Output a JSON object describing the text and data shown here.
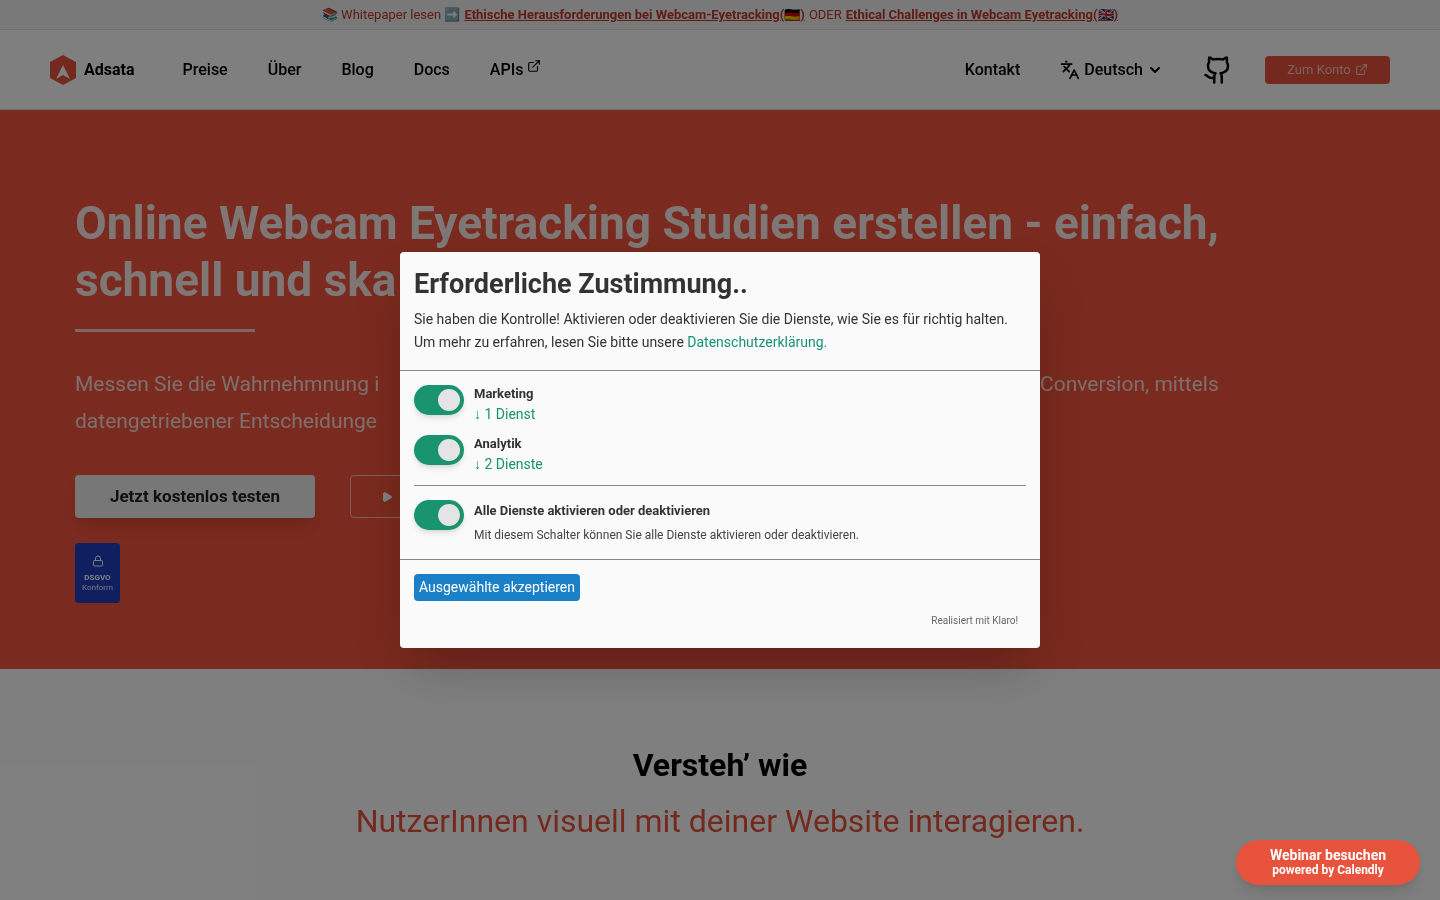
{
  "announcement": {
    "prefix": "📚 Whitepaper lesen ➡️",
    "link_de": "Ethische Herausforderungen bei Webcam-Eyetracking(🇩🇪)",
    "separator": "ODER",
    "link_en": "Ethical Challenges in Webcam Eyetracking(🇬🇧)"
  },
  "nav": {
    "brand": "Adsata",
    "items": [
      {
        "label": "Preise",
        "external": false
      },
      {
        "label": "Über",
        "external": false
      },
      {
        "label": "Blog",
        "external": false
      },
      {
        "label": "Docs",
        "external": false
      },
      {
        "label": "APIs",
        "external": true
      }
    ],
    "contact": "Kontakt",
    "language": "Deutsch",
    "account": "Zum Konto"
  },
  "hero": {
    "title_line_1": "Online Webcam Eyetracking Studien erstellen - einfach,",
    "title_line_2": "schnell und ska",
    "text_line_1_left": "Messen Sie die Wahrnehmnung i",
    "text_line_1_right": "Conversion, mittels",
    "text_line_2": "datengetriebener Entscheidunge",
    "cta": "Jetzt kostenlos testen",
    "badge_title": "DSGVO",
    "badge_subtitle": "Konform"
  },
  "section": {
    "title": "Versteh’ wie",
    "subtitle": "NutzerInnen visuell mit deiner Website interagieren."
  },
  "consent": {
    "title": "Erforderliche Zustimmung..",
    "intro": "Sie haben die Kontrolle! Aktivieren oder deaktivieren Sie die Dienste, wie Sie es für richtig halten. Um mehr zu erfahren, lesen Sie bitte unsere",
    "privacy_link": "Datenschutzerklärung.",
    "purposes": [
      {
        "name": "Marketing",
        "services": "↓ 1 Dienst",
        "on": true
      },
      {
        "name": "Analytik",
        "services": "↓ 2 Dienste",
        "on": true
      }
    ],
    "all": {
      "name": "Alle Dienste aktivieren oder deaktivieren",
      "description": "Mit diesem Schalter können Sie alle Dienste aktivieren oder deaktivieren.",
      "on": true
    },
    "accept": "Ausgewählte akzeptieren",
    "footer": "Realisiert mit Klaro!"
  },
  "webinar": {
    "title": "Webinar besuchen",
    "subtitle": "powered by Calendly"
  }
}
